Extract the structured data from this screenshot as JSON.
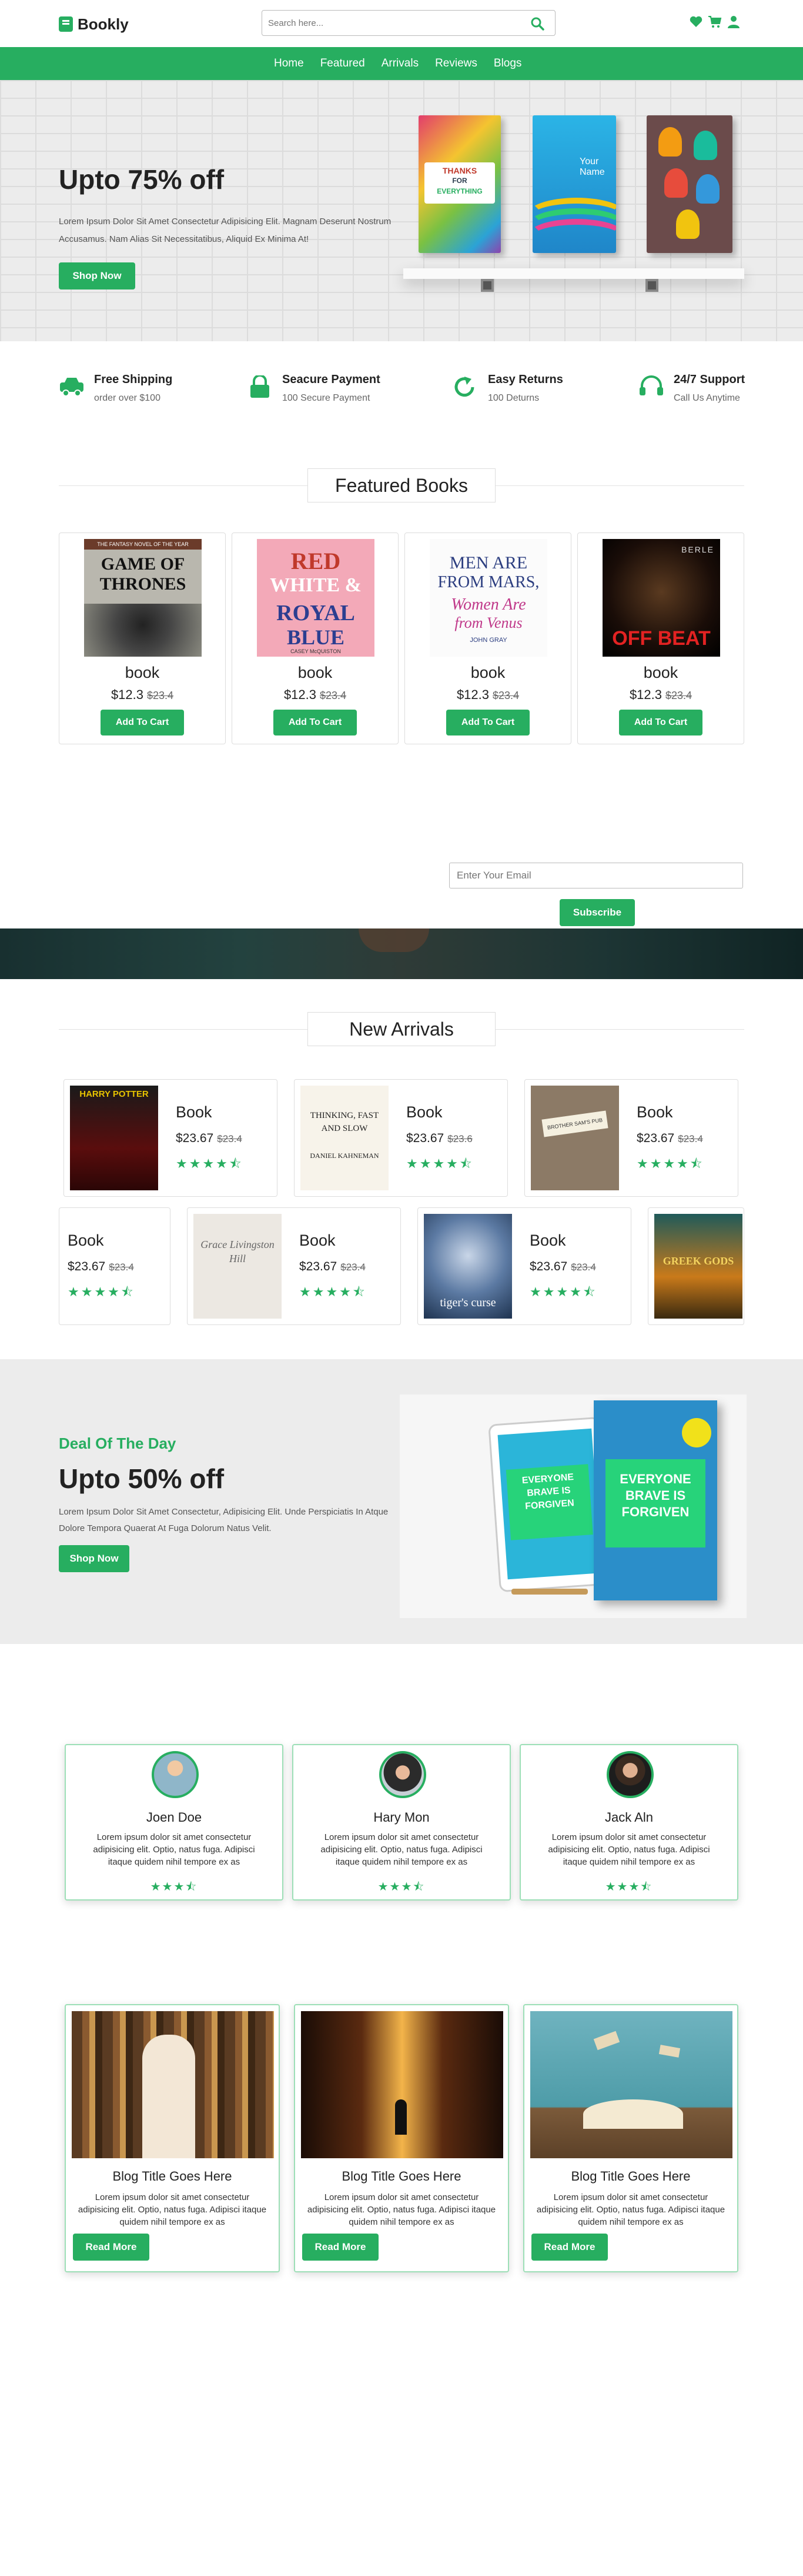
{
  "header": {
    "logo": "Bookly",
    "search_placeholder": "Search here...",
    "nav": [
      "Home",
      "Featured",
      "Arrivals",
      "Reviews",
      "Blogs"
    ]
  },
  "hero": {
    "title": "Upto 75% off",
    "text": "Lorem Ipsum Dolor Sit Amet Consectetur Adipisicing Elit. Magnam Deserunt Nostrum Accusamus. Nam Alias Sit Necessitatibus, Aliquid Ex Minima At!",
    "button": "Shop Now",
    "books": [
      {
        "top": "THANKS",
        "mid": "FOR",
        "bottom": "EVERYTHING"
      },
      {
        "top": "Your",
        "mid": "Name"
      }
    ]
  },
  "features": [
    {
      "icon": "truck-icon",
      "title": "Free Shipping",
      "sub": "order over $100"
    },
    {
      "icon": "lock-icon",
      "title": "Seacure Payment",
      "sub": "100 Secure Payment"
    },
    {
      "icon": "redo-icon",
      "title": "Easy Returns",
      "sub": "100 Deturns"
    },
    {
      "icon": "headset-icon",
      "title": "24/7 Support",
      "sub": "Call Us Anytime"
    }
  ],
  "featured": {
    "title": "Featured Books",
    "items": [
      {
        "title": "book",
        "price": "$12.3",
        "old": "$23.4",
        "button": "Add To Cart",
        "cover_top": "THE FANTASY NOVEL OF THE YEAR",
        "cover_a": "GAME OF",
        "cover_b": "THRONES"
      },
      {
        "title": "book",
        "price": "$12.3",
        "old": "$23.4",
        "button": "Add To Cart",
        "cover_a": "RED",
        "cover_b": "WHITE &",
        "cover_c": "ROYAL",
        "cover_d": "BLUE",
        "cover_e": "CASEY McQUISTON"
      },
      {
        "title": "book",
        "price": "$12.3",
        "old": "$23.4",
        "button": "Add To Cart",
        "cover_a": "MEN ARE",
        "cover_b": "FROM MARS,",
        "cover_c": "Women Are",
        "cover_d": "from Venus",
        "cover_e": "JOHN GRAY"
      },
      {
        "title": "book",
        "price": "$12.3",
        "old": "$23.4",
        "button": "Add To Cart",
        "cover_a": "OFF",
        "cover_b": "BEAT",
        "cover_top": "BERLE"
      }
    ]
  },
  "newsletter": {
    "placeholder": "Enter Your Email",
    "button": "Subscribe"
  },
  "arrivals": {
    "title": "New Arrivals",
    "row1": [
      {
        "title": "Book",
        "price": "$23.67",
        "old": "$23.4",
        "stars": "★★★★⯪",
        "cover": "HARRY POTTER"
      },
      {
        "title": "Book",
        "price": "$23.67",
        "old": "$23.6",
        "stars": "★★★★⯪",
        "cover": "THINKING, FAST AND SLOW",
        "author": "DANIEL KAHNEMAN"
      },
      {
        "title": "Book",
        "price": "$23.67",
        "old": "$23.4",
        "stars": "★★★★⯪",
        "cover": "BROTHER SAM'S PUB"
      }
    ],
    "row2": [
      {
        "title": "Book",
        "price": "$23.67",
        "old": "$23.4",
        "stars": "★★★★⯪"
      },
      {
        "title": "Book",
        "price": "$23.67",
        "old": "$23.4",
        "stars": "★★★★⯪",
        "cover": "Grace Livingston Hill"
      },
      {
        "title": "Book",
        "price": "$23.67",
        "old": "$23.4",
        "stars": "★★★★⯪",
        "cover": "tiger's curse"
      },
      {
        "cover": "GREEK GODS"
      }
    ]
  },
  "deal": {
    "kicker": "Deal Of The Day",
    "title": "Upto 50% off",
    "text": "Lorem Ipsum Dolor Sit Amet Consectetur, Adipisicing Elit. Unde Perspiciatis In Atque Dolore Tempora Quaerat At Fuga Dolorum Natus Velit.",
    "button": "Shop Now",
    "book_text": "EVERYONE BRAVE IS FORGIVEN"
  },
  "reviews": [
    {
      "name": "Joen Doe",
      "text": "Lorem ipsum dolor sit amet consectetur adipisicing elit. Optio, natus fuga. Adipisci itaque quidem nihil tempore ex as",
      "stars": "★★★⯪"
    },
    {
      "name": "Hary Mon",
      "text": "Lorem ipsum dolor sit amet consectetur adipisicing elit. Optio, natus fuga. Adipisci itaque quidem nihil tempore ex as",
      "stars": "★★★⯪"
    },
    {
      "name": "Jack Aln",
      "text": "Lorem ipsum dolor sit amet consectetur adipisicing elit. Optio, natus fuga. Adipisci itaque quidem nihil tempore ex as",
      "stars": "★★★⯪"
    }
  ],
  "blogs": [
    {
      "title": "Blog Title Goes Here",
      "text": "Lorem ipsum dolor sit amet consectetur adipisicing elit. Optio, natus fuga. Adipisci itaque quidem nihil tempore ex as",
      "button": "Read More"
    },
    {
      "title": "Blog Title Goes Here",
      "text": "Lorem ipsum dolor sit amet consectetur adipisicing elit. Optio, natus fuga. Adipisci itaque quidem nihil tempore ex as",
      "button": "Read More"
    },
    {
      "title": "Blog Title Goes Here",
      "text": "Lorem ipsum dolor sit amet consectetur adipisicing elit. Optio, natus fuga. Adipisci itaque quidem nihil tempore ex as",
      "button": "Read More"
    }
  ],
  "colors": {
    "accent": "#27ae60",
    "dark": "#222222",
    "light_bg": "#ececec"
  }
}
